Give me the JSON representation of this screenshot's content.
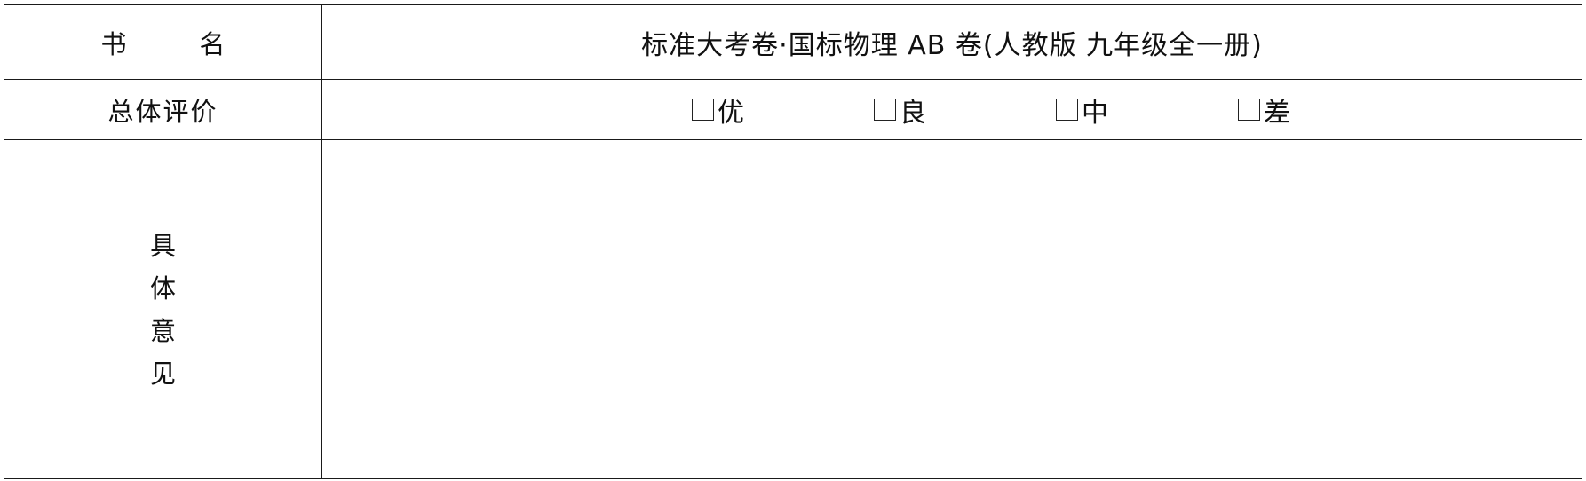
{
  "form": {
    "title_label_chars": [
      "书",
      "名"
    ],
    "title_value": "标准大考卷·国标物理 AB 卷(人教版   九年级全一册)",
    "rating_label": "总体评价",
    "rating_options": [
      {
        "label": "优",
        "checked": false
      },
      {
        "label": "良",
        "checked": false
      },
      {
        "label": "中",
        "checked": false
      },
      {
        "label": "差",
        "checked": false
      }
    ],
    "opinion_label_chars": [
      "具",
      "体",
      "意",
      "见"
    ],
    "opinion_value": ""
  }
}
